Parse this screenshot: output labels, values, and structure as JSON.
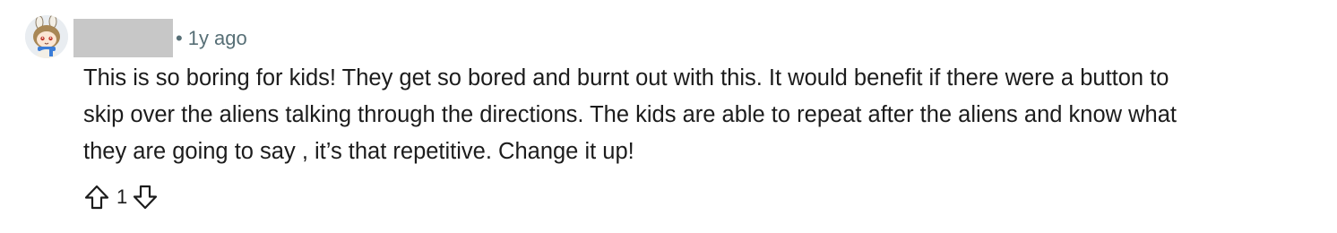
{
  "comment": {
    "author": "",
    "separator": "•",
    "timestamp": "1y ago",
    "body_lines": [
      "This is so boring for kids! They get so bored and burnt out with this. It would benefit if there were a button to",
      "skip over the aliens talking through the directions. The kids are able to repeat after the aliens and know what",
      "they are going to say , it’s that repetitive. Change it up!"
    ],
    "vote_count": "1",
    "icons": {
      "avatar": "user-avatar",
      "upvote": "upvote-arrow-icon",
      "downvote": "downvote-arrow-icon"
    },
    "colors": {
      "meta_text": "#576f76",
      "body_text": "#1c1c1c",
      "redaction": "#c7c7c7"
    }
  }
}
